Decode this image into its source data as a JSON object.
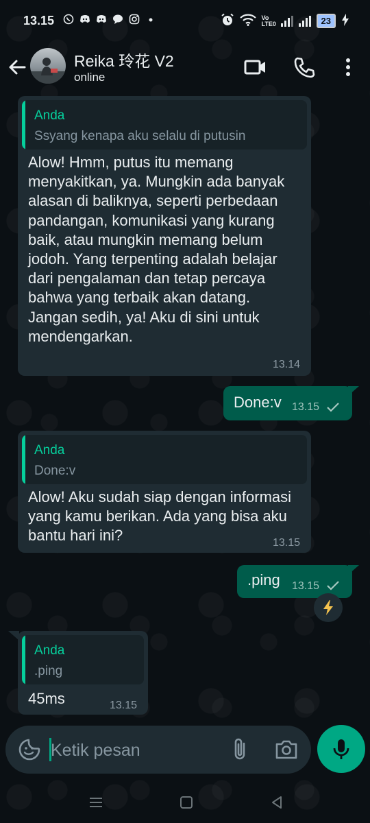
{
  "status_bar": {
    "time": "13.15",
    "notification_icons": [
      "whatsapp-icon",
      "discord-icon",
      "discord-icon",
      "chat-icon",
      "instagram-icon",
      "dot-icon"
    ],
    "right_icons": [
      "alarm-icon",
      "wifi-icon",
      "volte-icon",
      "signal-icon",
      "signal-icon",
      "battery-icon",
      "charging-icon"
    ],
    "volte_label": "Vo\nLTE0",
    "battery": "23"
  },
  "header": {
    "contact_name": "Reika 玲花 V2",
    "contact_status": "online"
  },
  "messages": [
    {
      "direction": "in",
      "quote_author": "Anda",
      "quote_text": "Ssyang kenapa aku selalu di putusin",
      "text": "Alow! Hmm, putus itu memang menyakitkan, ya. Mungkin ada banyak alasan di baliknya, seperti perbedaan pandangan, komunikasi yang kurang baik, atau mungkin memang belum jodoh. Yang terpenting adalah belajar dari pengalaman dan tetap percaya bahwa yang terbaik akan datang. Jangan sedih, ya! Aku di sini untuk mendengarkan.",
      "time": "13.14"
    },
    {
      "direction": "out",
      "text": "Done:v",
      "time": "13.15",
      "status": "sent"
    },
    {
      "direction": "in",
      "quote_author": "Anda",
      "quote_text": "Done:v",
      "text": "Alow! Aku sudah siap dengan informasi yang kamu berikan. Ada yang bisa aku bantu hari ini?",
      "time": "13.15"
    },
    {
      "direction": "out",
      "text": ".ping",
      "time": "13.15",
      "status": "sent"
    },
    {
      "direction": "in",
      "quote_author": "Anda",
      "quote_text": ".ping",
      "text": "45ms",
      "time": "13.15"
    }
  ],
  "input": {
    "placeholder": "Ketik pesan"
  },
  "colors": {
    "background": "#0b1014",
    "incoming_bubble": "#1f2c33",
    "outgoing_bubble": "#005c4b",
    "accent": "#00a884",
    "quote_accent": "#06cf9c"
  }
}
